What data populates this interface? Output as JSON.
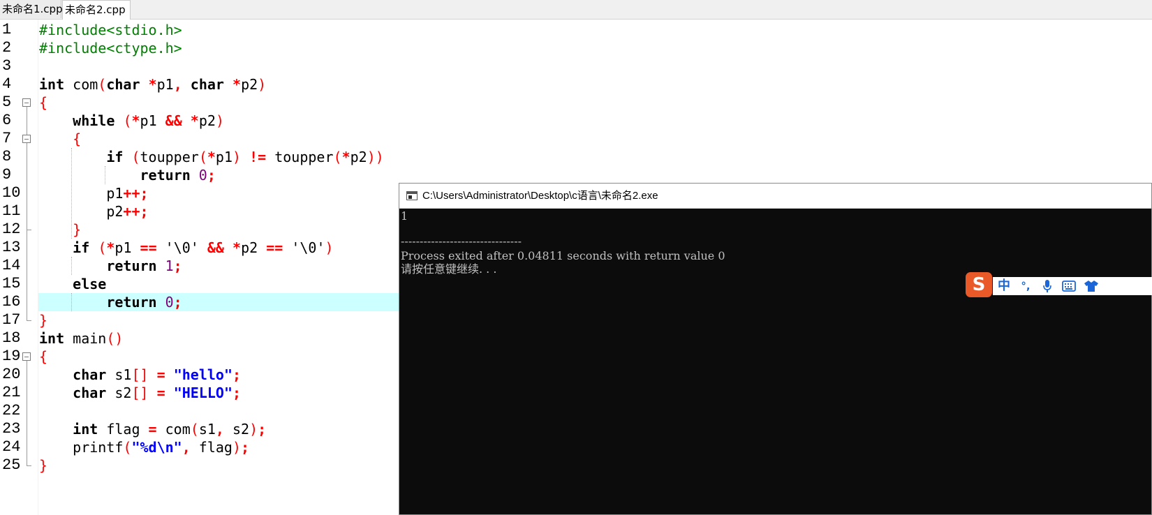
{
  "tabs": [
    {
      "label": "未命名1.cpp",
      "active": false
    },
    {
      "label": "未命名2.cpp",
      "active": true
    }
  ],
  "editor": {
    "line_numbers": [
      "1",
      "2",
      "3",
      "4",
      "5",
      "6",
      "7",
      "8",
      "9",
      "10",
      "11",
      "12",
      "13",
      "14",
      "15",
      "16",
      "17",
      "18",
      "19",
      "20",
      "21",
      "22",
      "23",
      "24",
      "25"
    ],
    "highlighted_line": 16,
    "lines": [
      [
        {
          "c": "pp",
          "t": "#include<stdio.h>"
        }
      ],
      [
        {
          "c": "pp",
          "t": "#include<ctype.h>"
        }
      ],
      [],
      [
        {
          "c": "kw",
          "t": "int"
        },
        {
          "c": "id",
          "t": " com"
        },
        {
          "c": "pn",
          "t": "("
        },
        {
          "c": "kw",
          "t": "char"
        },
        {
          "c": "id",
          "t": " "
        },
        {
          "c": "op",
          "t": "*"
        },
        {
          "c": "id",
          "t": "p1"
        },
        {
          "c": "op",
          "t": ","
        },
        {
          "c": "id",
          "t": " "
        },
        {
          "c": "kw",
          "t": "char"
        },
        {
          "c": "id",
          "t": " "
        },
        {
          "c": "op",
          "t": "*"
        },
        {
          "c": "id",
          "t": "p2"
        },
        {
          "c": "pn",
          "t": ")"
        }
      ],
      [
        {
          "c": "pn",
          "t": "{"
        }
      ],
      [
        {
          "c": "id",
          "t": "    "
        },
        {
          "c": "kw",
          "t": "while"
        },
        {
          "c": "id",
          "t": " "
        },
        {
          "c": "pn",
          "t": "("
        },
        {
          "c": "op",
          "t": "*"
        },
        {
          "c": "id",
          "t": "p1 "
        },
        {
          "c": "op",
          "t": "&&"
        },
        {
          "c": "id",
          "t": " "
        },
        {
          "c": "op",
          "t": "*"
        },
        {
          "c": "id",
          "t": "p2"
        },
        {
          "c": "pn",
          "t": ")"
        }
      ],
      [
        {
          "c": "id",
          "t": "    "
        },
        {
          "c": "pn",
          "t": "{"
        }
      ],
      [
        {
          "c": "id",
          "t": "        "
        },
        {
          "c": "kw",
          "t": "if"
        },
        {
          "c": "id",
          "t": " "
        },
        {
          "c": "pn",
          "t": "("
        },
        {
          "c": "id",
          "t": "toupper"
        },
        {
          "c": "pn",
          "t": "("
        },
        {
          "c": "op",
          "t": "*"
        },
        {
          "c": "id",
          "t": "p1"
        },
        {
          "c": "pn",
          "t": ")"
        },
        {
          "c": "id",
          "t": " "
        },
        {
          "c": "op",
          "t": "!="
        },
        {
          "c": "id",
          "t": " toupper"
        },
        {
          "c": "pn",
          "t": "("
        },
        {
          "c": "op",
          "t": "*"
        },
        {
          "c": "id",
          "t": "p2"
        },
        {
          "c": "pn",
          "t": "))"
        }
      ],
      [
        {
          "c": "id",
          "t": "            "
        },
        {
          "c": "kw",
          "t": "return"
        },
        {
          "c": "id",
          "t": " "
        },
        {
          "c": "num",
          "t": "0"
        },
        {
          "c": "op",
          "t": ";"
        }
      ],
      [
        {
          "c": "id",
          "t": "        p1"
        },
        {
          "c": "op",
          "t": "++;"
        }
      ],
      [
        {
          "c": "id",
          "t": "        p2"
        },
        {
          "c": "op",
          "t": "++;"
        }
      ],
      [
        {
          "c": "id",
          "t": "    "
        },
        {
          "c": "pn",
          "t": "}"
        }
      ],
      [
        {
          "c": "id",
          "t": "    "
        },
        {
          "c": "kw",
          "t": "if"
        },
        {
          "c": "id",
          "t": " "
        },
        {
          "c": "pn",
          "t": "("
        },
        {
          "c": "op",
          "t": "*"
        },
        {
          "c": "id",
          "t": "p1 "
        },
        {
          "c": "op",
          "t": "=="
        },
        {
          "c": "id",
          "t": " "
        },
        {
          "c": "chr",
          "t": "'\\0'"
        },
        {
          "c": "id",
          "t": " "
        },
        {
          "c": "op",
          "t": "&&"
        },
        {
          "c": "id",
          "t": " "
        },
        {
          "c": "op",
          "t": "*"
        },
        {
          "c": "id",
          "t": "p2 "
        },
        {
          "c": "op",
          "t": "=="
        },
        {
          "c": "id",
          "t": " "
        },
        {
          "c": "chr",
          "t": "'\\0'"
        },
        {
          "c": "pn",
          "t": ")"
        }
      ],
      [
        {
          "c": "id",
          "t": "        "
        },
        {
          "c": "kw",
          "t": "return"
        },
        {
          "c": "id",
          "t": " "
        },
        {
          "c": "num",
          "t": "1"
        },
        {
          "c": "op",
          "t": ";"
        }
      ],
      [
        {
          "c": "id",
          "t": "    "
        },
        {
          "c": "kw",
          "t": "else"
        }
      ],
      [
        {
          "c": "id",
          "t": "        "
        },
        {
          "c": "kw",
          "t": "return"
        },
        {
          "c": "id",
          "t": " "
        },
        {
          "c": "num",
          "t": "0"
        },
        {
          "c": "op",
          "t": ";"
        }
      ],
      [
        {
          "c": "pn",
          "t": "}"
        }
      ],
      [
        {
          "c": "kw",
          "t": "int"
        },
        {
          "c": "id",
          "t": " main"
        },
        {
          "c": "pn",
          "t": "()"
        }
      ],
      [
        {
          "c": "pn",
          "t": "{"
        }
      ],
      [
        {
          "c": "id",
          "t": "    "
        },
        {
          "c": "kw",
          "t": "char"
        },
        {
          "c": "id",
          "t": " s1"
        },
        {
          "c": "pn",
          "t": "[]"
        },
        {
          "c": "id",
          "t": " "
        },
        {
          "c": "op",
          "t": "="
        },
        {
          "c": "id",
          "t": " "
        },
        {
          "c": "str",
          "t": "\"hello\""
        },
        {
          "c": "op",
          "t": ";"
        }
      ],
      [
        {
          "c": "id",
          "t": "    "
        },
        {
          "c": "kw",
          "t": "char"
        },
        {
          "c": "id",
          "t": " s2"
        },
        {
          "c": "pn",
          "t": "[]"
        },
        {
          "c": "id",
          "t": " "
        },
        {
          "c": "op",
          "t": "="
        },
        {
          "c": "id",
          "t": " "
        },
        {
          "c": "str",
          "t": "\"HELLO\""
        },
        {
          "c": "op",
          "t": ";"
        }
      ],
      [],
      [
        {
          "c": "id",
          "t": "    "
        },
        {
          "c": "kw",
          "t": "int"
        },
        {
          "c": "id",
          "t": " flag "
        },
        {
          "c": "op",
          "t": "="
        },
        {
          "c": "id",
          "t": " com"
        },
        {
          "c": "pn",
          "t": "("
        },
        {
          "c": "id",
          "t": "s1"
        },
        {
          "c": "op",
          "t": ","
        },
        {
          "c": "id",
          "t": " s2"
        },
        {
          "c": "pn",
          "t": ")"
        },
        {
          "c": "op",
          "t": ";"
        }
      ],
      [
        {
          "c": "id",
          "t": "    printf"
        },
        {
          "c": "pn",
          "t": "("
        },
        {
          "c": "str",
          "t": "\"%d\\n\""
        },
        {
          "c": "op",
          "t": ","
        },
        {
          "c": "id",
          "t": " flag"
        },
        {
          "c": "pn",
          "t": ")"
        },
        {
          "c": "op",
          "t": ";"
        }
      ],
      [
        {
          "c": "pn",
          "t": "}"
        }
      ]
    ]
  },
  "console": {
    "title": "C:\\Users\\Administrator\\Desktop\\c语言\\未命名2.exe",
    "output": {
      "result": "1",
      "separator": "--------------------------------",
      "exit_message": "Process exited after 0.04811 seconds with return value 0",
      "prompt": "请按任意键继续. . ."
    }
  },
  "ime": {
    "logo": "S",
    "mode_label": "中",
    "punct_label": "°,",
    "icons": [
      "microphone-icon",
      "keyboard-icon",
      "skin-icon"
    ]
  }
}
